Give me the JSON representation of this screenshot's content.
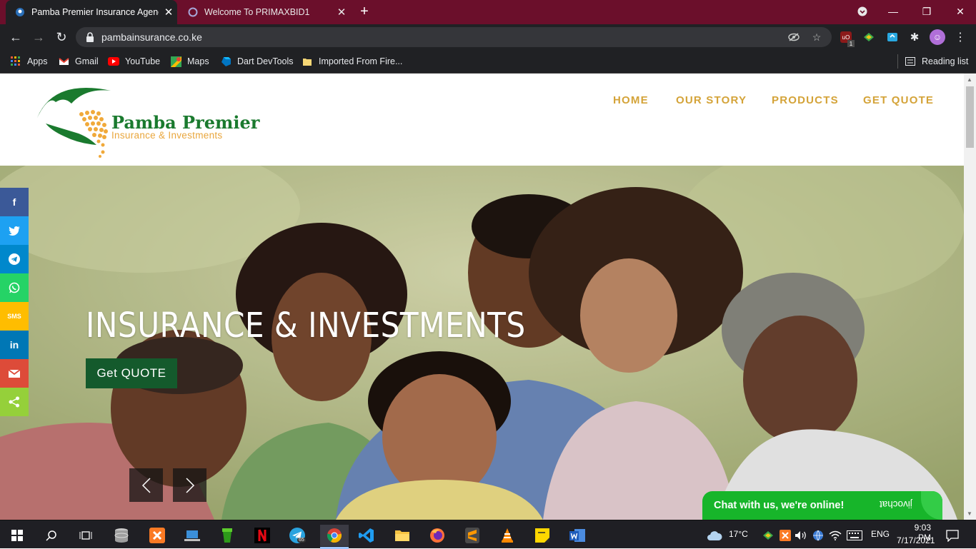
{
  "browser": {
    "tabs": [
      {
        "title": "Pamba Premier Insurance Agency",
        "active": true
      },
      {
        "title": "Welcome To PRIMAXBID1",
        "active": false
      }
    ],
    "url": "pambainsurance.co.ke",
    "bookmarks": [
      {
        "label": "Apps",
        "icon": "apps-grid-icon"
      },
      {
        "label": "Gmail",
        "icon": "gmail-icon"
      },
      {
        "label": "YouTube",
        "icon": "youtube-icon"
      },
      {
        "label": "Maps",
        "icon": "maps-icon"
      },
      {
        "label": "Dart DevTools",
        "icon": "dart-icon"
      },
      {
        "label": "Imported From Fire...",
        "icon": "folder-icon"
      }
    ],
    "reading_list": "Reading list",
    "extension_badge": "1"
  },
  "site": {
    "logo": {
      "name": "Pamba Premier",
      "tagline": "Insurance & Investments"
    },
    "nav": [
      "HOME",
      "OUR STORY",
      "PRODUCTS",
      "GET QUOTE"
    ],
    "hero": {
      "title": "INSURANCE & INVESTMENTS",
      "cta": "Get QUOTE"
    },
    "share_buttons": [
      {
        "name": "facebook",
        "glyph": "f",
        "color": "#3b5998"
      },
      {
        "name": "twitter",
        "glyph": "🐦",
        "color": "#1da1f2"
      },
      {
        "name": "telegram",
        "glyph": "➤",
        "color": "#0088cc"
      },
      {
        "name": "whatsapp",
        "glyph": "✆",
        "color": "#25d366"
      },
      {
        "name": "sms",
        "glyph": "SMS",
        "color": "#ffbd00"
      },
      {
        "name": "linkedin",
        "glyph": "in",
        "color": "#0077b5"
      },
      {
        "name": "email",
        "glyph": "✉",
        "color": "#dd4b39"
      },
      {
        "name": "share",
        "glyph": "<",
        "color": "#95d03a"
      }
    ],
    "chat": {
      "text": "Chat with us, we're online!",
      "brand": "jivochat"
    }
  },
  "taskbar": {
    "weather": "17°C",
    "lang": "ENG",
    "time": "9:03 PM",
    "date": "7/17/2021",
    "telegram_badge": "65"
  },
  "colors": {
    "nav_gold": "#d4a338",
    "logo_green": "#1a7a2e",
    "chat_green": "#17b52a",
    "tab_bar": "#6b0f2b"
  }
}
